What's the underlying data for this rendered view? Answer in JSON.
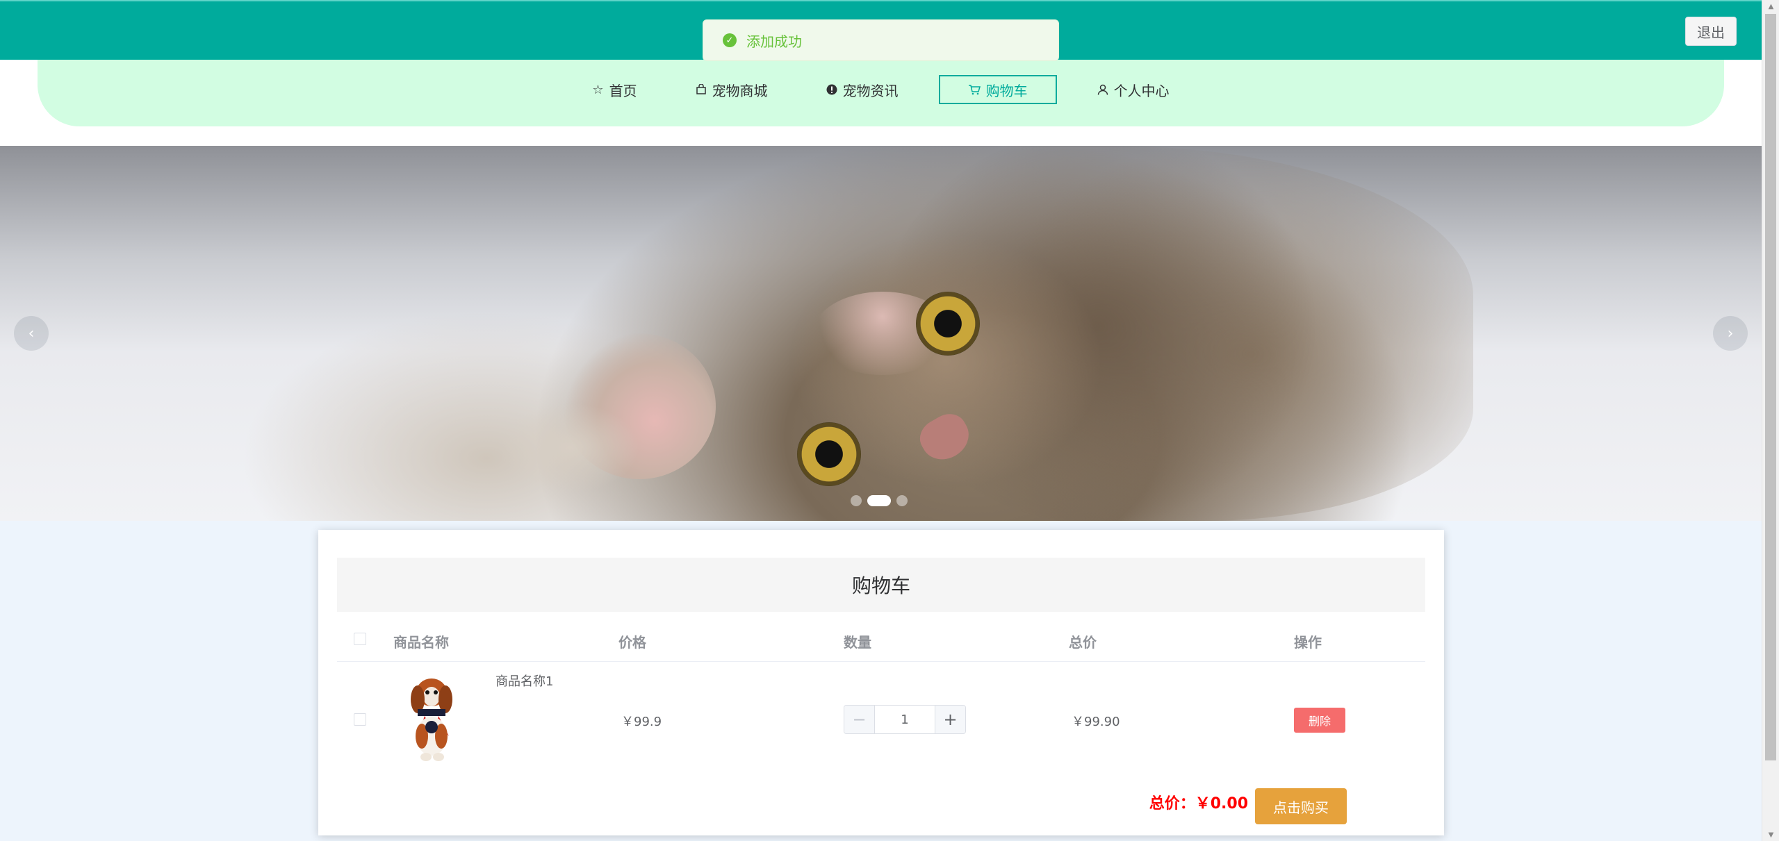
{
  "toast": {
    "text": "添加成功",
    "icon": "check-circle-icon",
    "color": "#67c23a"
  },
  "header": {
    "logout_label": "退出",
    "bg_color": "#00ab9c"
  },
  "nav": {
    "items": [
      {
        "label": "首页",
        "icon": "star-icon"
      },
      {
        "label": "宠物商城",
        "icon": "bag-icon"
      },
      {
        "label": "宠物资讯",
        "icon": "info-icon"
      },
      {
        "label": "购物车",
        "icon": "cart-icon",
        "active": true
      },
      {
        "label": "个人中心",
        "icon": "user-icon"
      }
    ]
  },
  "banner": {
    "arrow_left": "‹",
    "arrow_right": "›",
    "slides": 3,
    "active_slide": 2
  },
  "cart": {
    "title": "购物车",
    "columns": [
      "商品名称",
      "价格",
      "数量",
      "总价",
      "操作"
    ],
    "rows": [
      {
        "name": "商品名称1",
        "price": "￥99.9",
        "quantity": "1",
        "subtotal": "￥99.90",
        "action": "删除"
      }
    ],
    "stepper": {
      "minus": "−",
      "plus": "+"
    },
    "total_label": "总价：￥0.00",
    "buy_label": "点击购买"
  }
}
